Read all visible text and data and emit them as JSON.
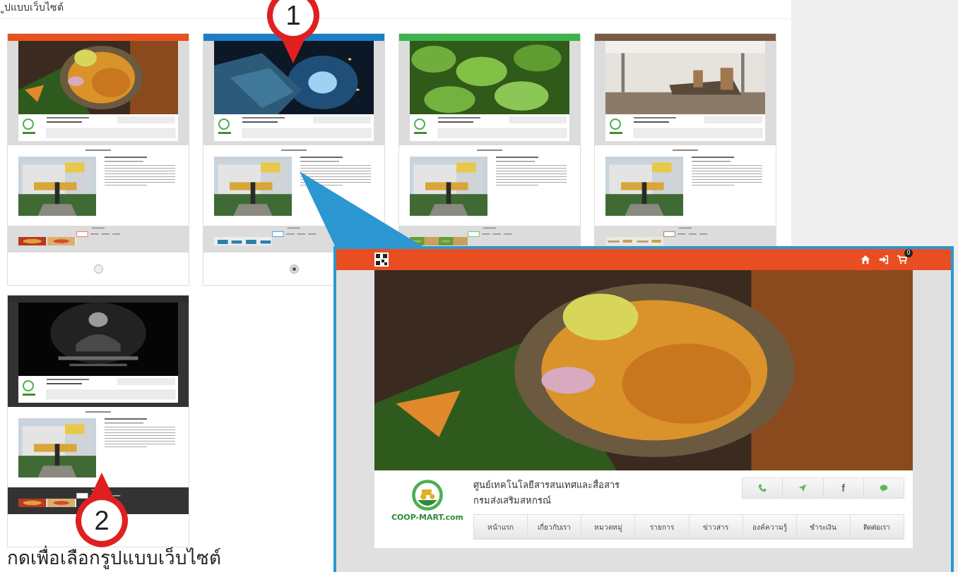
{
  "page_title": "ูปแบบเว็บไซต์",
  "templates": [
    {
      "kind": "food",
      "color": "#e8501f",
      "dark": false,
      "selected": false
    },
    {
      "kind": "welding",
      "color": "#1b7fc6",
      "dark": false,
      "selected": true
    },
    {
      "kind": "greens",
      "color": "#3cb44a",
      "dark": false
    },
    {
      "kind": "office",
      "color": "#7b5a46",
      "dark": false
    },
    {
      "kind": "memorial",
      "color": "#2e2e2e",
      "dark": true
    }
  ],
  "markers": [
    {
      "label": "1"
    },
    {
      "label": "2"
    }
  ],
  "instruction": "กดเพื่อเลือกรูปแบบเว็บไซต์",
  "preview": {
    "cart_count": "0",
    "logo_text": "COOP-MART.com",
    "org_name": "ศูนย์เทคโนโลยีสารสนเทศและสื่อสาร",
    "org_subname": "กรมส่งเสริมสหกรณ์",
    "contact_buttons": [
      {
        "kind": "phone"
      },
      {
        "kind": "send"
      },
      {
        "kind": "text",
        "label": "f"
      },
      {
        "kind": "chat"
      }
    ],
    "nav": [
      "หน้าแรก",
      "เกี่ยวกับเรา",
      "หมวดหมู่",
      "รายการ",
      "ข่าวสาร",
      "องค์ความรู้",
      "ชำระเงิน",
      "ติดต่อเรา"
    ]
  }
}
